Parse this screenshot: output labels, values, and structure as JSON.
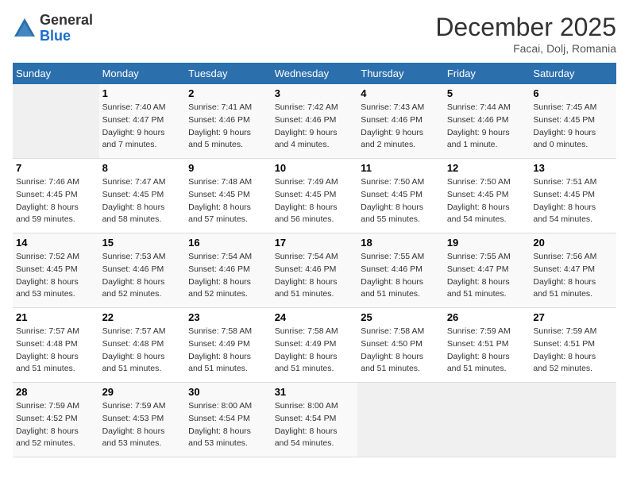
{
  "logo": {
    "general": "General",
    "blue": "Blue"
  },
  "header": {
    "month": "December 2025",
    "location": "Facai, Dolj, Romania"
  },
  "weekdays": [
    "Sunday",
    "Monday",
    "Tuesday",
    "Wednesday",
    "Thursday",
    "Friday",
    "Saturday"
  ],
  "weeks": [
    [
      {
        "day": "",
        "info": ""
      },
      {
        "day": "1",
        "info": "Sunrise: 7:40 AM\nSunset: 4:47 PM\nDaylight: 9 hours\nand 7 minutes."
      },
      {
        "day": "2",
        "info": "Sunrise: 7:41 AM\nSunset: 4:46 PM\nDaylight: 9 hours\nand 5 minutes."
      },
      {
        "day": "3",
        "info": "Sunrise: 7:42 AM\nSunset: 4:46 PM\nDaylight: 9 hours\nand 4 minutes."
      },
      {
        "day": "4",
        "info": "Sunrise: 7:43 AM\nSunset: 4:46 PM\nDaylight: 9 hours\nand 2 minutes."
      },
      {
        "day": "5",
        "info": "Sunrise: 7:44 AM\nSunset: 4:46 PM\nDaylight: 9 hours\nand 1 minute."
      },
      {
        "day": "6",
        "info": "Sunrise: 7:45 AM\nSunset: 4:45 PM\nDaylight: 9 hours\nand 0 minutes."
      }
    ],
    [
      {
        "day": "7",
        "info": "Sunrise: 7:46 AM\nSunset: 4:45 PM\nDaylight: 8 hours\nand 59 minutes."
      },
      {
        "day": "8",
        "info": "Sunrise: 7:47 AM\nSunset: 4:45 PM\nDaylight: 8 hours\nand 58 minutes."
      },
      {
        "day": "9",
        "info": "Sunrise: 7:48 AM\nSunset: 4:45 PM\nDaylight: 8 hours\nand 57 minutes."
      },
      {
        "day": "10",
        "info": "Sunrise: 7:49 AM\nSunset: 4:45 PM\nDaylight: 8 hours\nand 56 minutes."
      },
      {
        "day": "11",
        "info": "Sunrise: 7:50 AM\nSunset: 4:45 PM\nDaylight: 8 hours\nand 55 minutes."
      },
      {
        "day": "12",
        "info": "Sunrise: 7:50 AM\nSunset: 4:45 PM\nDaylight: 8 hours\nand 54 minutes."
      },
      {
        "day": "13",
        "info": "Sunrise: 7:51 AM\nSunset: 4:45 PM\nDaylight: 8 hours\nand 54 minutes."
      }
    ],
    [
      {
        "day": "14",
        "info": "Sunrise: 7:52 AM\nSunset: 4:45 PM\nDaylight: 8 hours\nand 53 minutes."
      },
      {
        "day": "15",
        "info": "Sunrise: 7:53 AM\nSunset: 4:46 PM\nDaylight: 8 hours\nand 52 minutes."
      },
      {
        "day": "16",
        "info": "Sunrise: 7:54 AM\nSunset: 4:46 PM\nDaylight: 8 hours\nand 52 minutes."
      },
      {
        "day": "17",
        "info": "Sunrise: 7:54 AM\nSunset: 4:46 PM\nDaylight: 8 hours\nand 51 minutes."
      },
      {
        "day": "18",
        "info": "Sunrise: 7:55 AM\nSunset: 4:46 PM\nDaylight: 8 hours\nand 51 minutes."
      },
      {
        "day": "19",
        "info": "Sunrise: 7:55 AM\nSunset: 4:47 PM\nDaylight: 8 hours\nand 51 minutes."
      },
      {
        "day": "20",
        "info": "Sunrise: 7:56 AM\nSunset: 4:47 PM\nDaylight: 8 hours\nand 51 minutes."
      }
    ],
    [
      {
        "day": "21",
        "info": "Sunrise: 7:57 AM\nSunset: 4:48 PM\nDaylight: 8 hours\nand 51 minutes."
      },
      {
        "day": "22",
        "info": "Sunrise: 7:57 AM\nSunset: 4:48 PM\nDaylight: 8 hours\nand 51 minutes."
      },
      {
        "day": "23",
        "info": "Sunrise: 7:58 AM\nSunset: 4:49 PM\nDaylight: 8 hours\nand 51 minutes."
      },
      {
        "day": "24",
        "info": "Sunrise: 7:58 AM\nSunset: 4:49 PM\nDaylight: 8 hours\nand 51 minutes."
      },
      {
        "day": "25",
        "info": "Sunrise: 7:58 AM\nSunset: 4:50 PM\nDaylight: 8 hours\nand 51 minutes."
      },
      {
        "day": "26",
        "info": "Sunrise: 7:59 AM\nSunset: 4:51 PM\nDaylight: 8 hours\nand 51 minutes."
      },
      {
        "day": "27",
        "info": "Sunrise: 7:59 AM\nSunset: 4:51 PM\nDaylight: 8 hours\nand 52 minutes."
      }
    ],
    [
      {
        "day": "28",
        "info": "Sunrise: 7:59 AM\nSunset: 4:52 PM\nDaylight: 8 hours\nand 52 minutes."
      },
      {
        "day": "29",
        "info": "Sunrise: 7:59 AM\nSunset: 4:53 PM\nDaylight: 8 hours\nand 53 minutes."
      },
      {
        "day": "30",
        "info": "Sunrise: 8:00 AM\nSunset: 4:54 PM\nDaylight: 8 hours\nand 53 minutes."
      },
      {
        "day": "31",
        "info": "Sunrise: 8:00 AM\nSunset: 4:54 PM\nDaylight: 8 hours\nand 54 minutes."
      },
      {
        "day": "",
        "info": ""
      },
      {
        "day": "",
        "info": ""
      },
      {
        "day": "",
        "info": ""
      }
    ]
  ]
}
